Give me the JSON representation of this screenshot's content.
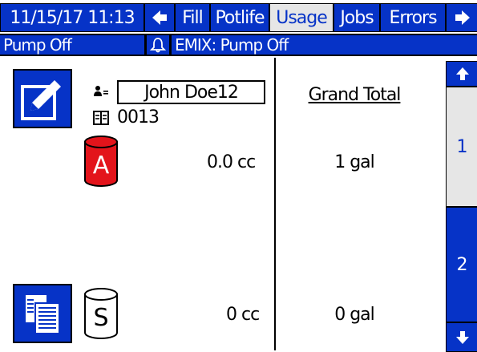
{
  "header": {
    "datetime": "11/15/17 11:13",
    "tabs": [
      {
        "label": "Fill"
      },
      {
        "label": "Potlife"
      },
      {
        "label": "Usage"
      },
      {
        "label": "Jobs"
      },
      {
        "label": "Errors"
      }
    ],
    "selected_tab": "Usage"
  },
  "status": {
    "pump_state": "Pump Off",
    "alarm_message": "EMIX: Pump Off"
  },
  "job": {
    "user_name": "John Doe12",
    "job_number": "0013"
  },
  "usage": {
    "material_a": {
      "label": "A",
      "amount": "0.0 cc",
      "grand_total": "1 gal",
      "color": "#e3141b"
    },
    "solvent": {
      "label": "S",
      "amount": "0 cc",
      "grand_total": "0 gal"
    }
  },
  "columns": {
    "grand_total_header": "Grand Total"
  },
  "pages": [
    {
      "label": "1"
    },
    {
      "label": "2"
    }
  ],
  "colors": {
    "accent": "#0633c7",
    "selected_background": "#e6e6e6"
  }
}
